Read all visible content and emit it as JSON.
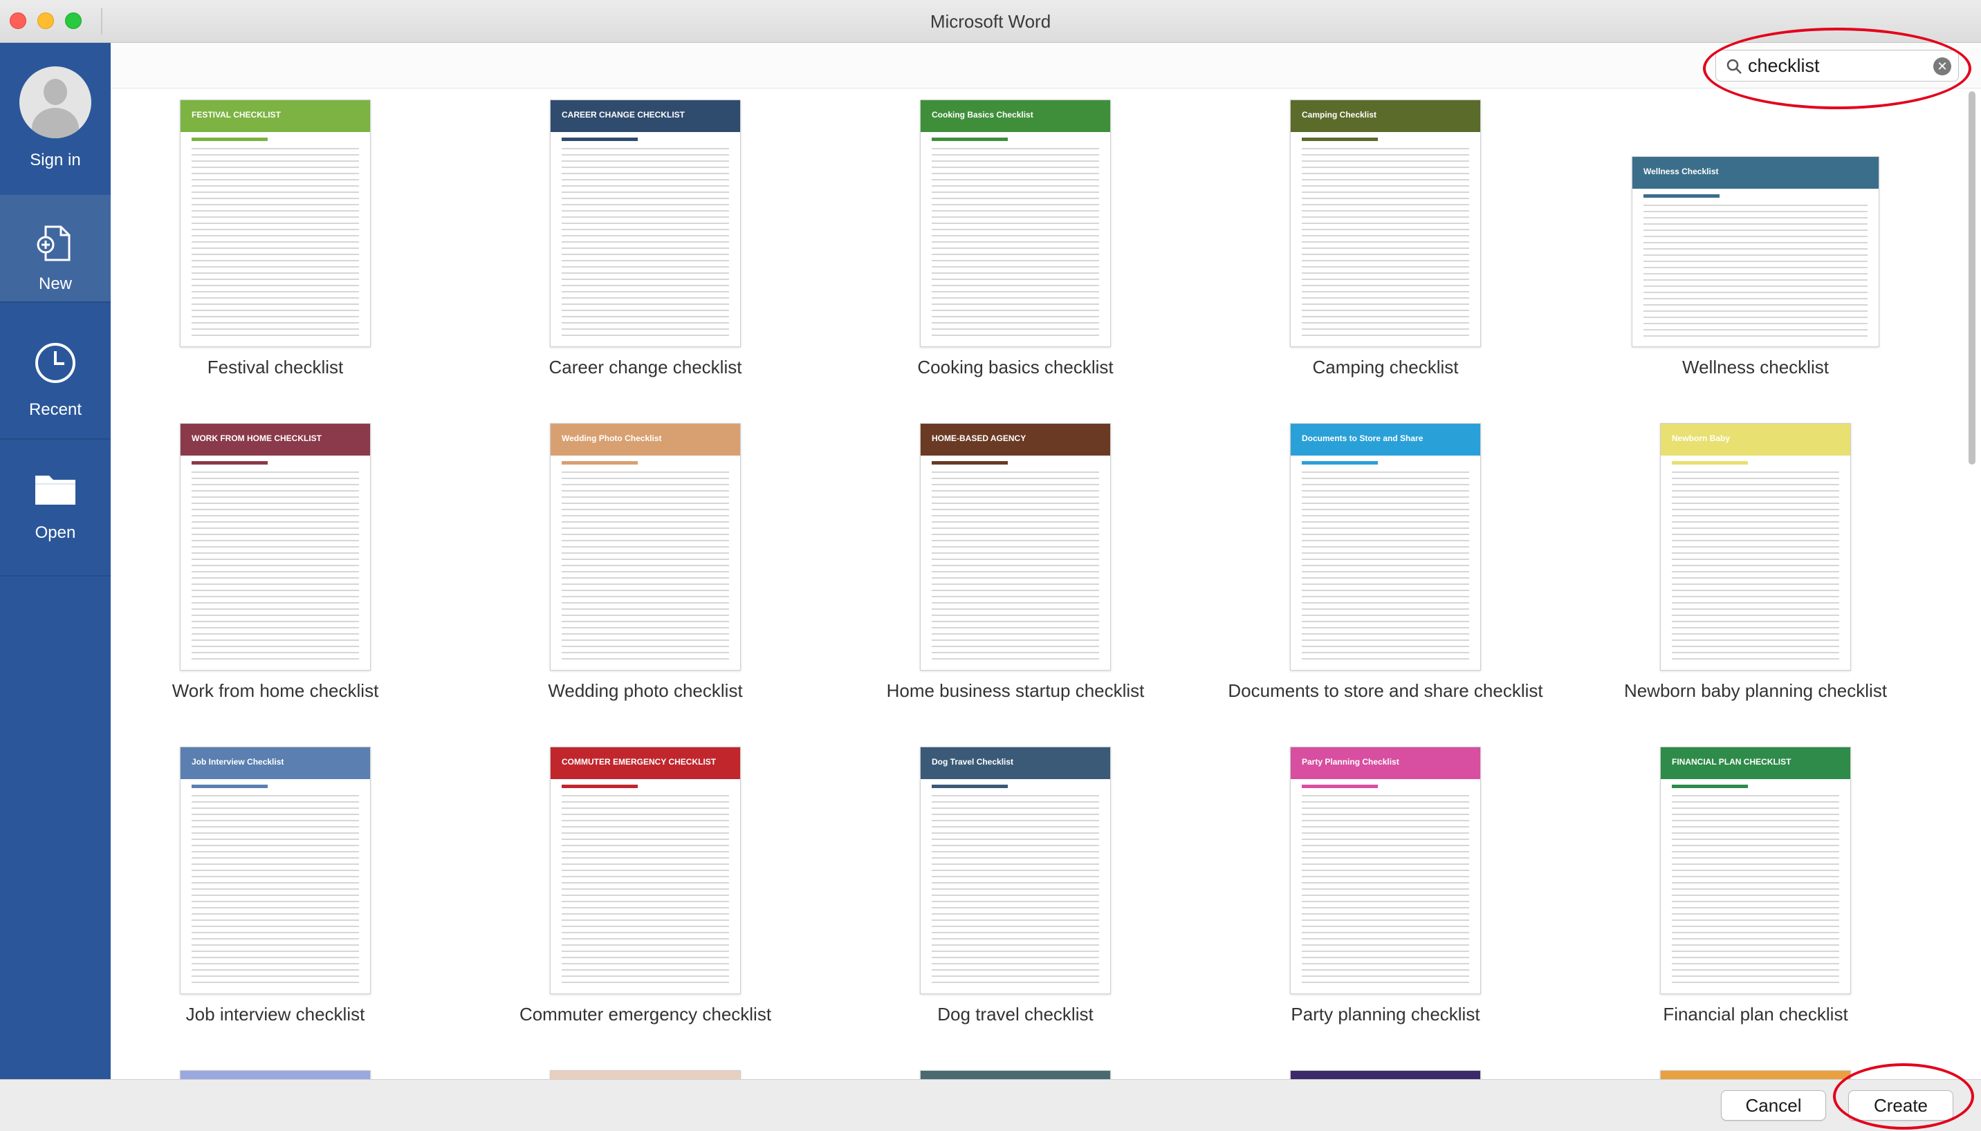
{
  "window": {
    "title": "Microsoft Word"
  },
  "sidebar": {
    "items": [
      {
        "label": "Sign in",
        "icon": "user-avatar-icon"
      },
      {
        "label": "New",
        "icon": "new-document-icon"
      },
      {
        "label": "Recent",
        "icon": "clock-icon"
      },
      {
        "label": "Open",
        "icon": "folder-icon"
      }
    ]
  },
  "search": {
    "value": "checklist",
    "placeholder": ""
  },
  "templates": [
    {
      "label": "Festival checklist",
      "banner": "FESTIVAL CHECKLIST",
      "color": "#7cb342"
    },
    {
      "label": "Career change checklist",
      "banner": "CAREER CHANGE CHECKLIST",
      "color": "#2f4b6e"
    },
    {
      "label": "Cooking basics checklist",
      "banner": "Cooking Basics Checklist",
      "color": "#3f8f3a"
    },
    {
      "label": "Camping checklist",
      "banner": "Camping Checklist",
      "color": "#5b6b2a"
    },
    {
      "label": "Wellness checklist",
      "banner": "Wellness Checklist",
      "color": "#3b6e8a"
    },
    {
      "label": "Work from home checklist",
      "banner": "WORK FROM HOME CHECKLIST",
      "color": "#8a3a4a"
    },
    {
      "label": "Wedding photo checklist",
      "banner": "Wedding Photo Checklist",
      "color": "#d8a070"
    },
    {
      "label": "Home business startup checklist",
      "banner": "HOME-BASED AGENCY",
      "color": "#6a3a24"
    },
    {
      "label": "Documents to store and share checklist",
      "banner": "Documents to Store and Share",
      "color": "#2aa0d8"
    },
    {
      "label": "Newborn baby planning checklist",
      "banner": "Newborn Baby",
      "color": "#e8e070"
    },
    {
      "label": "Job interview checklist",
      "banner": "Job Interview Checklist",
      "color": "#5a7fb0"
    },
    {
      "label": "Commuter emergency checklist",
      "banner": "COMMUTER EMERGENCY CHECKLIST",
      "color": "#c0262c"
    },
    {
      "label": "Dog travel checklist",
      "banner": "Dog Travel Checklist",
      "color": "#3a5a78"
    },
    {
      "label": "Party planning checklist",
      "banner": "Party Planning Checklist",
      "color": "#d84ea0"
    },
    {
      "label": "Financial plan checklist",
      "banner": "FINANCIAL PLAN CHECKLIST",
      "color": "#2e8b4a"
    }
  ],
  "footer": {
    "cancel_label": "Cancel",
    "create_label": "Create"
  },
  "colors": {
    "sidebar": "#2b579a",
    "annotation": "#e3001b"
  }
}
